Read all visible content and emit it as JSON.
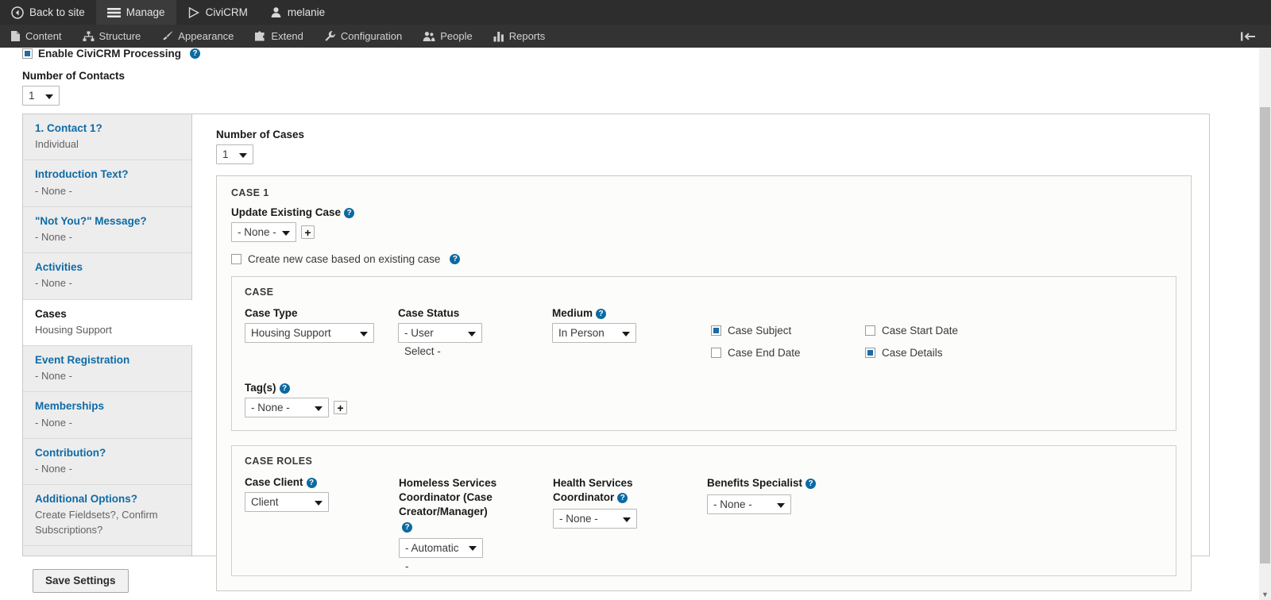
{
  "toolbar": {
    "top_items": [
      {
        "label": "Back to site",
        "icon": "back-arrow-icon",
        "active": false
      },
      {
        "label": "Manage",
        "icon": "hamburger-icon",
        "active": true
      },
      {
        "label": "CiviCRM",
        "icon": "civicrm-icon",
        "active": false
      },
      {
        "label": "melanie",
        "icon": "user-icon",
        "active": false
      }
    ],
    "menu_items": [
      {
        "label": "Content",
        "icon": "document-icon"
      },
      {
        "label": "Structure",
        "icon": "sitemap-icon"
      },
      {
        "label": "Appearance",
        "icon": "paintbrush-icon"
      },
      {
        "label": "Extend",
        "icon": "puzzle-icon"
      },
      {
        "label": "Configuration",
        "icon": "wrench-icon"
      },
      {
        "label": "People",
        "icon": "people-icon"
      },
      {
        "label": "Reports",
        "icon": "bar-chart-icon"
      }
    ],
    "collapse_icon": "collapse-toolbar-icon"
  },
  "enable_processing": {
    "label": "Enable CiviCRM Processing",
    "checked": true,
    "help_icon": "help-icon"
  },
  "number_of_contacts": {
    "label": "Number of Contacts",
    "value": "1"
  },
  "sidebar": {
    "items": [
      {
        "title": "1. Contact 1?",
        "subtitle": "Individual",
        "active": false
      },
      {
        "title": "Introduction Text?",
        "subtitle": "- None -",
        "active": false
      },
      {
        "title": "\"Not You?\" Message?",
        "subtitle": "- None -",
        "active": false
      },
      {
        "title": "Activities",
        "subtitle": "- None -",
        "active": false
      },
      {
        "title": "Cases",
        "subtitle": "Housing Support",
        "active": true
      },
      {
        "title": "Event Registration",
        "subtitle": "- None -",
        "active": false
      },
      {
        "title": "Memberships",
        "subtitle": "- None -",
        "active": false
      },
      {
        "title": "Contribution?",
        "subtitle": "- None -",
        "active": false
      },
      {
        "title": "Additional Options?",
        "subtitle": "Create Fieldsets?, Confirm Subscriptions?",
        "active": false
      }
    ]
  },
  "main": {
    "number_of_cases": {
      "label": "Number of Cases",
      "value": "1"
    },
    "case_legend": "CASE 1",
    "update_existing_case": {
      "label": "Update Existing Case",
      "value": "- None -",
      "help_icon": "help-icon",
      "add_icon": "plus-icon"
    },
    "create_new_case": {
      "label": "Create new case based on existing case",
      "checked": false,
      "help_icon": "help-icon"
    },
    "case_fieldset": {
      "legend": "CASE",
      "case_type": {
        "label": "Case Type",
        "value": "Housing Support"
      },
      "case_status": {
        "label": "Case Status",
        "value": "- User Select -"
      },
      "medium": {
        "label": "Medium",
        "value": "In Person",
        "help_icon": "help-icon"
      },
      "tags": {
        "label": "Tag(s)",
        "value": "- None -",
        "help_icon": "help-icon",
        "add_icon": "plus-icon"
      },
      "checkboxes": [
        {
          "label": "Case Subject",
          "checked": true
        },
        {
          "label": "Case Start Date",
          "checked": false
        },
        {
          "label": "Case End Date",
          "checked": false
        },
        {
          "label": "Case Details",
          "checked": true
        }
      ]
    },
    "case_roles": {
      "legend": "CASE ROLES",
      "fields": [
        {
          "label": "Case Client",
          "value": "Client",
          "help_icon": "help-icon"
        },
        {
          "label": "Homeless Services Coordinator (Case Creator/Manager)",
          "value": "- Automatic -",
          "help_icon": "help-icon"
        },
        {
          "label": "Health Services Coordinator",
          "value": "- None -",
          "help_icon": "help-icon"
        },
        {
          "label": "Benefits Specialist",
          "value": "- None -",
          "help_icon": "help-icon"
        }
      ]
    }
  },
  "save_button": {
    "label": "Save Settings"
  },
  "colors": {
    "link": "#0f6ba5",
    "accent": "#1b6ca8",
    "toolbar_top": "#2d2d2d",
    "toolbar_bottom": "#333333",
    "sidebar_bg": "#ededed"
  }
}
